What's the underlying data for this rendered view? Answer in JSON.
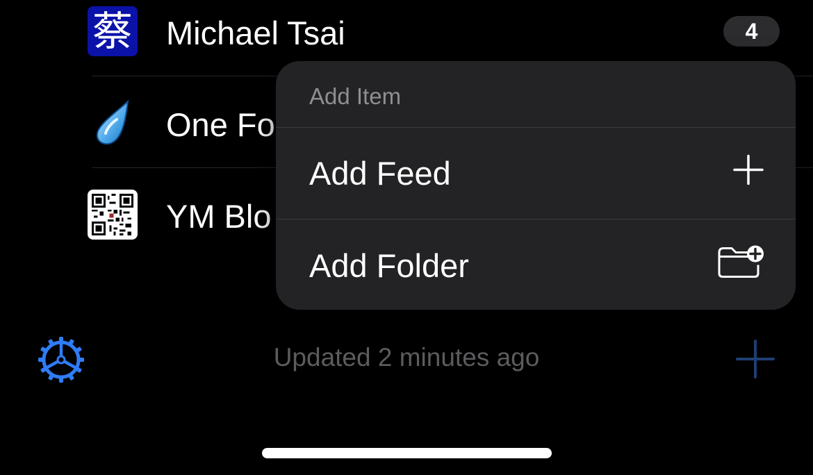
{
  "feeds": [
    {
      "title": "Michael Tsai",
      "icon": "kanji-cai-icon",
      "icon_text": "蔡",
      "unread": "4"
    },
    {
      "title": "One Fo",
      "icon": "water-drop-icon"
    },
    {
      "title": "YM Blo",
      "icon": "qr-code-icon"
    }
  ],
  "toolbar": {
    "status": "Updated 2 minutes ago",
    "settings_icon": "gear-icon",
    "add_icon": "plus-icon"
  },
  "menu": {
    "header": "Add Item",
    "items": [
      {
        "label": "Add Feed",
        "icon": "plus-icon"
      },
      {
        "label": "Add Folder",
        "icon": "folder-plus-icon"
      }
    ]
  },
  "colors": {
    "accent": "#2f7cf6",
    "kanji_icon_bg": "#0b12a8",
    "menu_bg": "#232325",
    "badge_bg": "#2c2c2e",
    "secondary_text": "#8e8e93",
    "status_text": "#5c5c5f"
  }
}
